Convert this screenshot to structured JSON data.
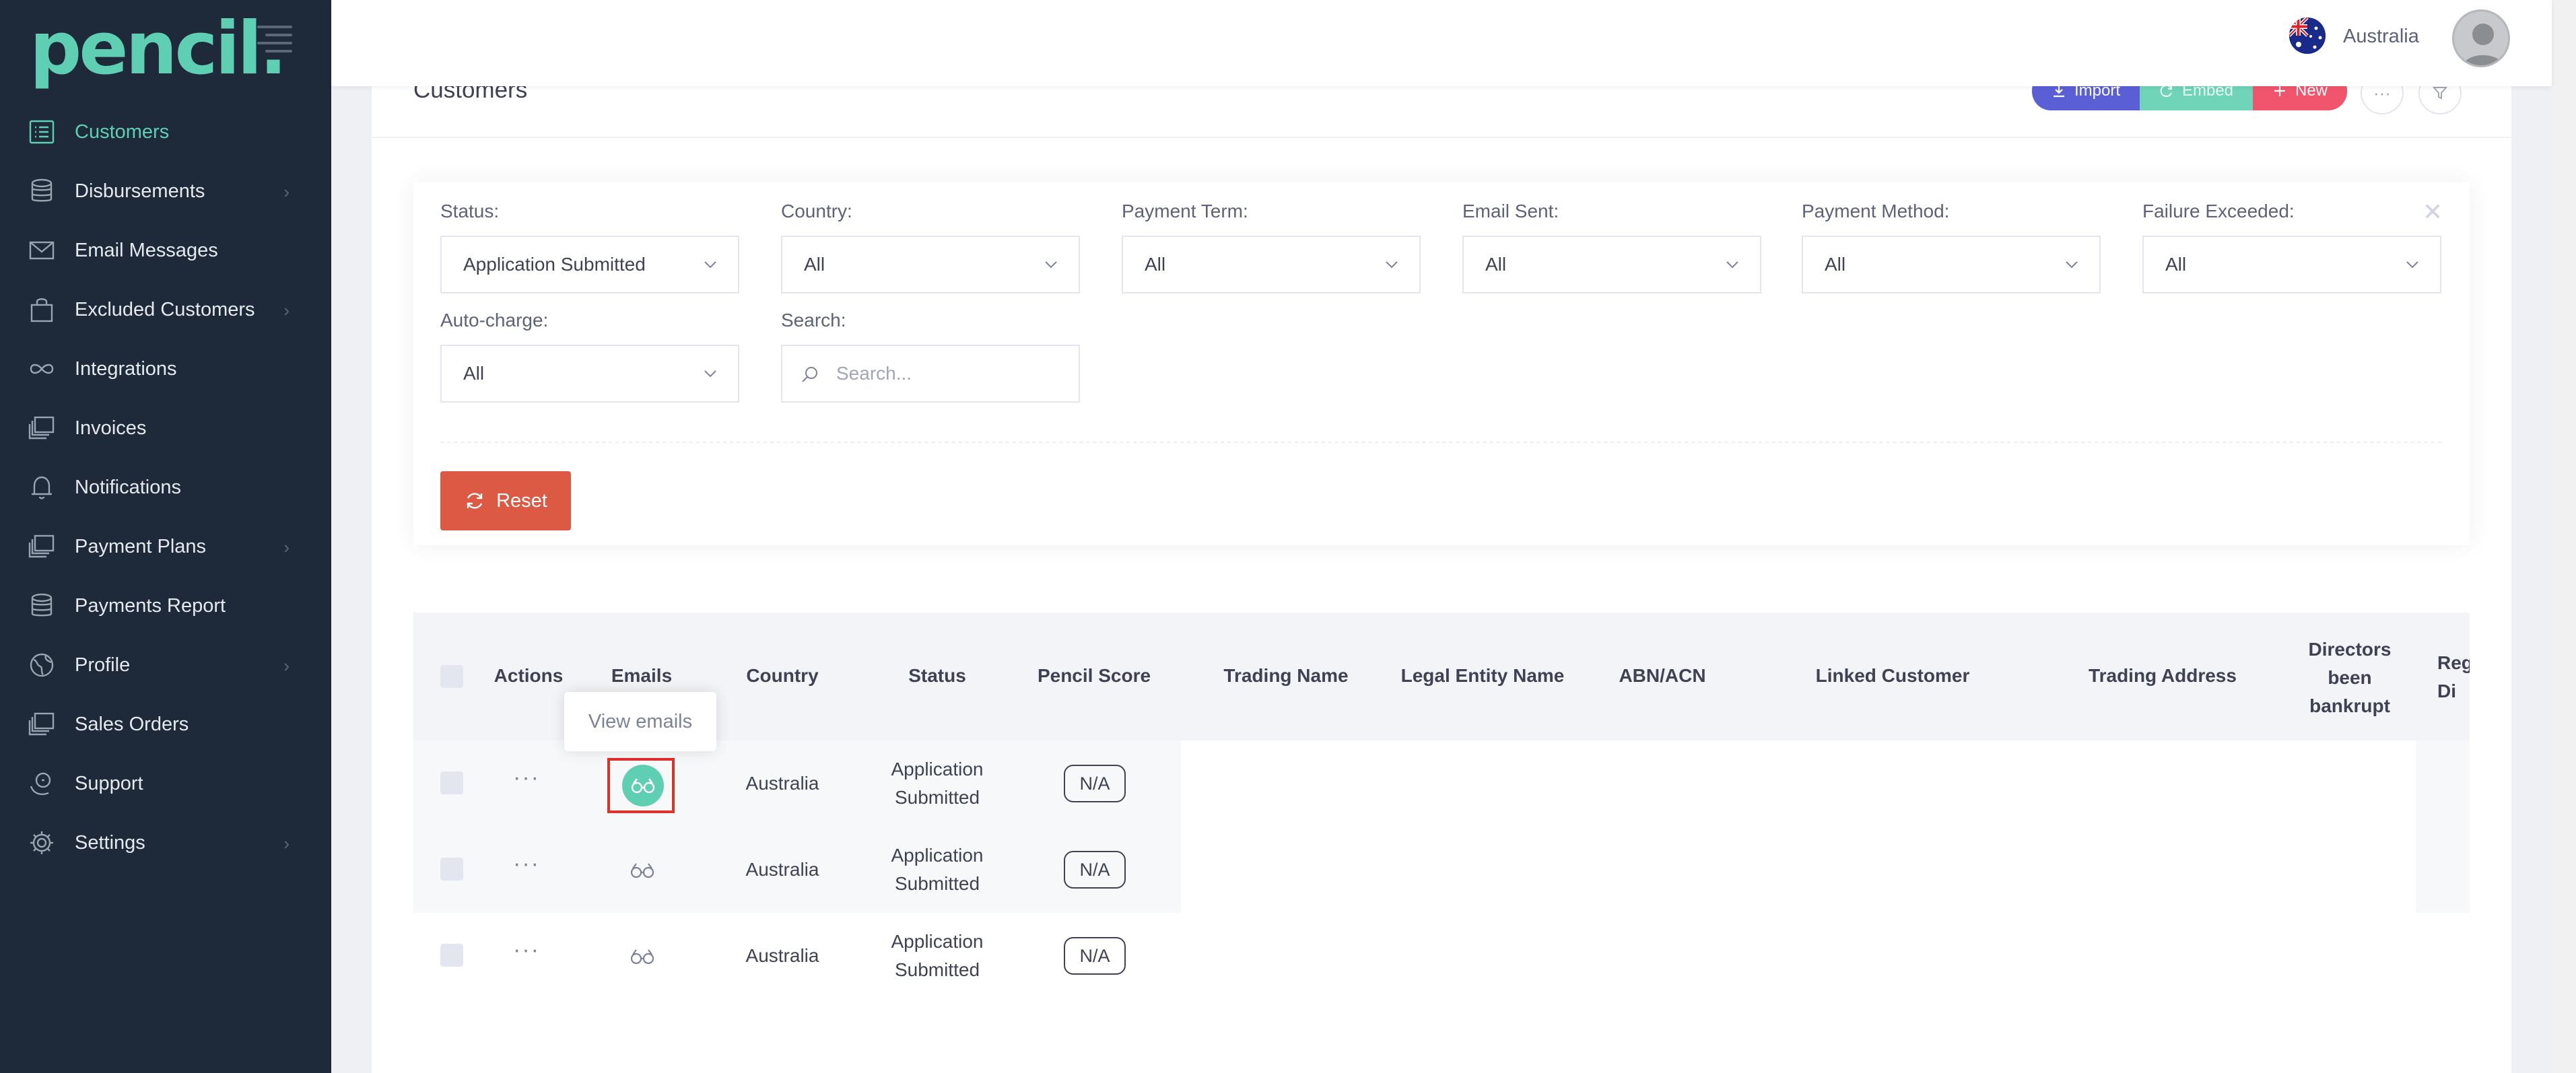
{
  "brand": {
    "logo_text": "pencil",
    "logo_dot": "."
  },
  "sidebar": {
    "items": [
      {
        "label": "Customers",
        "icon": "list-icon",
        "active": true,
        "chevron": false
      },
      {
        "label": "Disbursements",
        "icon": "database-icon",
        "active": false,
        "chevron": true
      },
      {
        "label": "Email Messages",
        "icon": "envelope-icon",
        "active": false,
        "chevron": false
      },
      {
        "label": "Excluded Customers",
        "icon": "bag-icon",
        "active": false,
        "chevron": true
      },
      {
        "label": "Integrations",
        "icon": "infinity-icon",
        "active": false,
        "chevron": false
      },
      {
        "label": "Invoices",
        "icon": "layers-icon",
        "active": false,
        "chevron": false
      },
      {
        "label": "Notifications",
        "icon": "bell-icon",
        "active": false,
        "chevron": false
      },
      {
        "label": "Payment Plans",
        "icon": "layers-icon",
        "active": false,
        "chevron": true
      },
      {
        "label": "Payments Report",
        "icon": "database-icon",
        "active": false,
        "chevron": false
      },
      {
        "label": "Profile",
        "icon": "globe-icon",
        "active": false,
        "chevron": true
      },
      {
        "label": "Sales Orders",
        "icon": "layers-icon",
        "active": false,
        "chevron": false
      },
      {
        "label": "Support",
        "icon": "headset-icon",
        "active": false,
        "chevron": false
      },
      {
        "label": "Settings",
        "icon": "gear-icon",
        "active": false,
        "chevron": true
      }
    ]
  },
  "header": {
    "country": "Australia"
  },
  "page": {
    "title": "Customers",
    "actions": {
      "import": "Import",
      "embed": "Embed",
      "new": "New"
    }
  },
  "filters": {
    "status": {
      "label": "Status:",
      "value": "Application Submitted"
    },
    "country": {
      "label": "Country:",
      "value": "All"
    },
    "payment_term": {
      "label": "Payment Term:",
      "value": "All"
    },
    "email_sent": {
      "label": "Email Sent:",
      "value": "All"
    },
    "payment_method": {
      "label": "Payment Method:",
      "value": "All"
    },
    "failure_exceeded": {
      "label": "Failure Exceeded:",
      "value": "All"
    },
    "auto_charge": {
      "label": "Auto-charge:",
      "value": "All"
    },
    "search": {
      "label": "Search:",
      "placeholder": "Search..."
    },
    "reset": "Reset"
  },
  "table": {
    "headers": {
      "actions": "Actions",
      "emails": "Emails",
      "country": "Country",
      "status": "Status",
      "pencil_score": "Pencil Score",
      "trading_name": "Trading Name",
      "legal_entity_name": "Legal Entity Name",
      "abn_acn": "ABN/ACN",
      "linked_customer": "Linked Customer",
      "trading_address": "Trading Address",
      "directors_l1": "Directors",
      "directors_l2": "been",
      "directors_l3": "bankrupt",
      "cut_l1": "Reg",
      "cut_l2": "Di"
    },
    "rows": [
      {
        "country": "Australia",
        "status_l1": "Application",
        "status_l2": "Submitted",
        "score": "N/A"
      },
      {
        "country": "Australia",
        "status_l1": "Application",
        "status_l2": "Submitted",
        "score": "N/A"
      },
      {
        "country": "Australia",
        "status_l1": "Application",
        "status_l2": "Submitted",
        "score": "N/A"
      }
    ],
    "tooltip": "View emails"
  },
  "colors": {
    "sidebar_bg": "#1e2a3a",
    "brand_green": "#5fcfb3",
    "import_blue": "#5b5fd6",
    "new_red": "#f0556d",
    "reset_red": "#dc5a43",
    "highlight_red": "#e0302a"
  }
}
